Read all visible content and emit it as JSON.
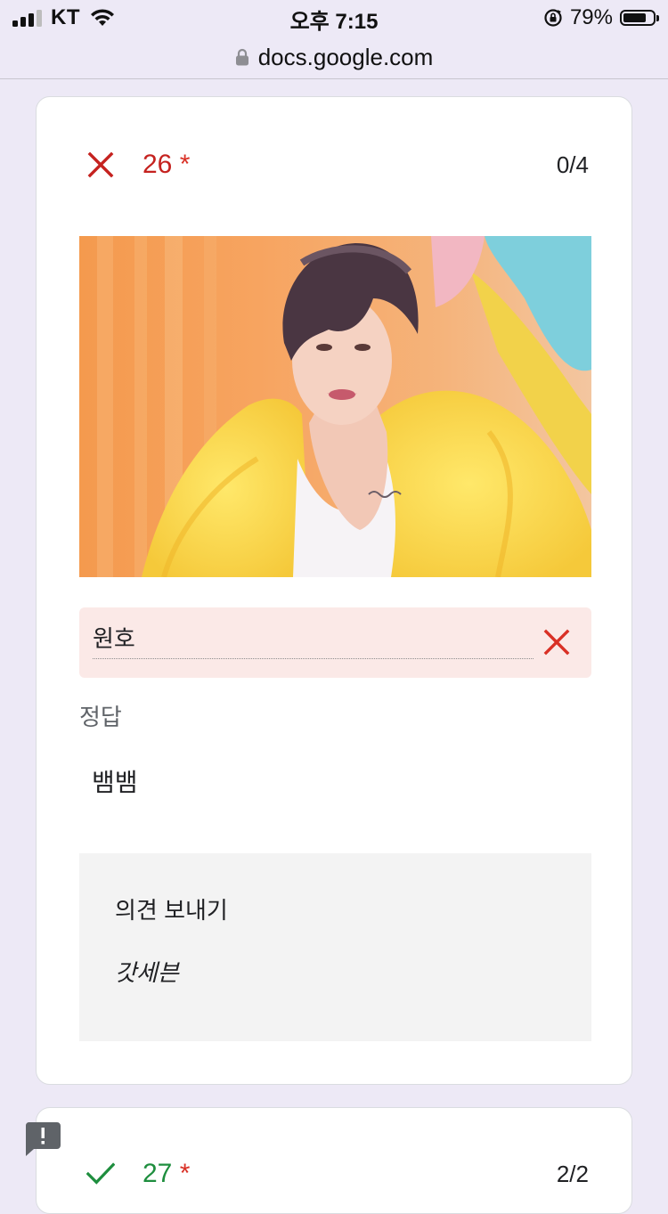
{
  "status_bar": {
    "carrier": "KT",
    "time": "오후 7:15",
    "battery_percent": "79%",
    "battery_level": 0.79,
    "icons": [
      "signal-icon",
      "wifi-icon",
      "rotation-lock-icon",
      "battery-icon"
    ]
  },
  "browser": {
    "url": "docs.google.com",
    "icon": "lock-icon"
  },
  "question": {
    "number": "26",
    "required_mark": "*",
    "score": "0/4",
    "status": "incorrect",
    "status_color": "#c5221f",
    "image_alt": "photo",
    "user_answer": "원호",
    "correct_answer_label": "정답",
    "correct_answer": "뱀뱀",
    "feedback_title": "의견 보내기",
    "feedback_text": "갓세븐"
  },
  "next_question": {
    "number": "27",
    "required_mark": "*",
    "score": "2/2",
    "status": "correct",
    "status_color": "#1e8e3e"
  },
  "report_icon": "report-problem-icon"
}
